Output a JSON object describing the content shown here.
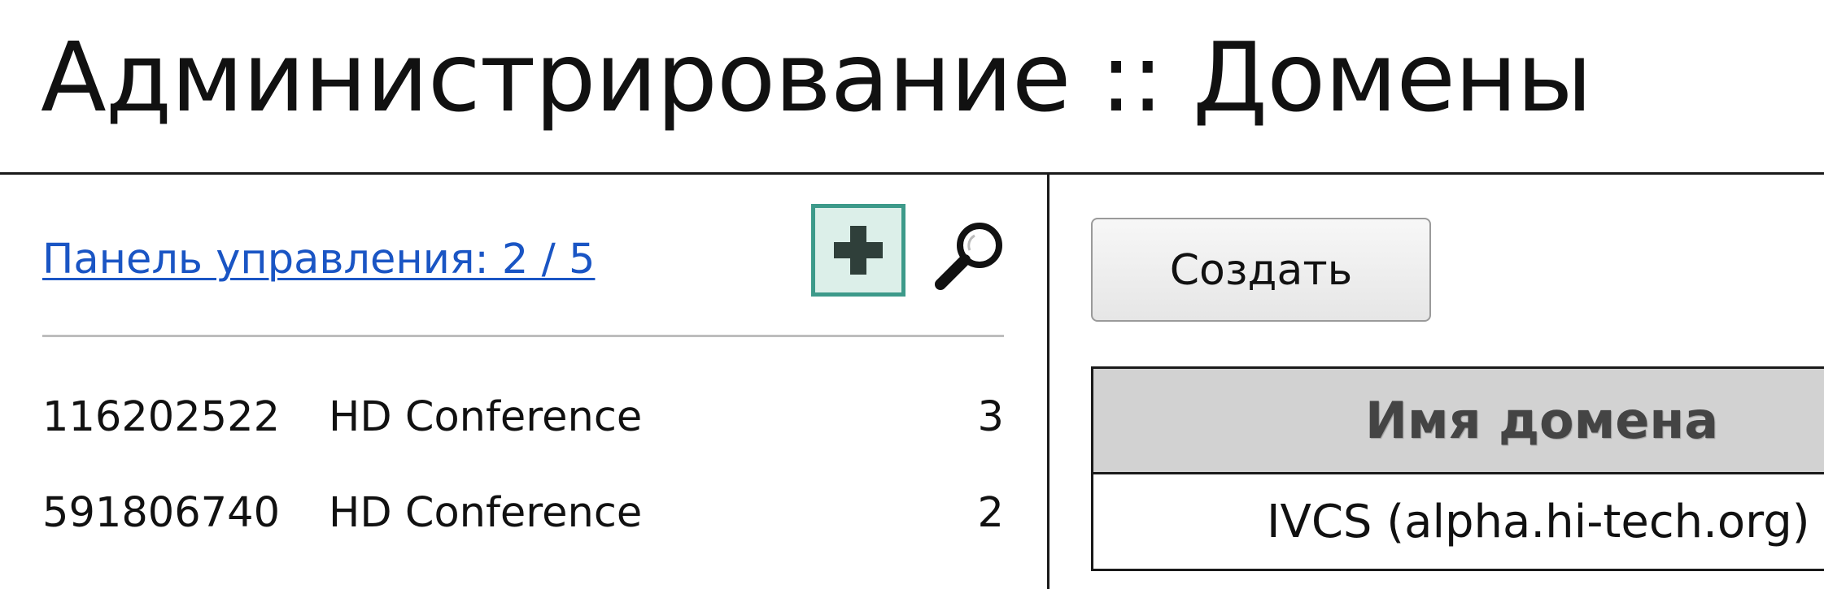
{
  "header": {
    "title": "Администрирование :: Домены"
  },
  "left_panel": {
    "control_panel_link": "Панель управления: 2 / 5",
    "add_icon": "plus-icon",
    "search_icon": "magnifier-icon",
    "rows": [
      {
        "id": "116202522",
        "name": "HD Conference",
        "count": "3"
      },
      {
        "id": "591806740",
        "name": "HD Conference",
        "count": "2"
      }
    ]
  },
  "right_panel": {
    "create_label": "Создать",
    "table": {
      "column_header": "Имя домена",
      "rows": [
        {
          "domain": "IVCS (alpha.hi-tech.org)"
        }
      ]
    }
  },
  "colors": {
    "link": "#1a55c4",
    "add_button_border": "#3d9a8a",
    "add_button_fill": "#dcefe9",
    "table_header_bg": "#d2d2d2"
  }
}
